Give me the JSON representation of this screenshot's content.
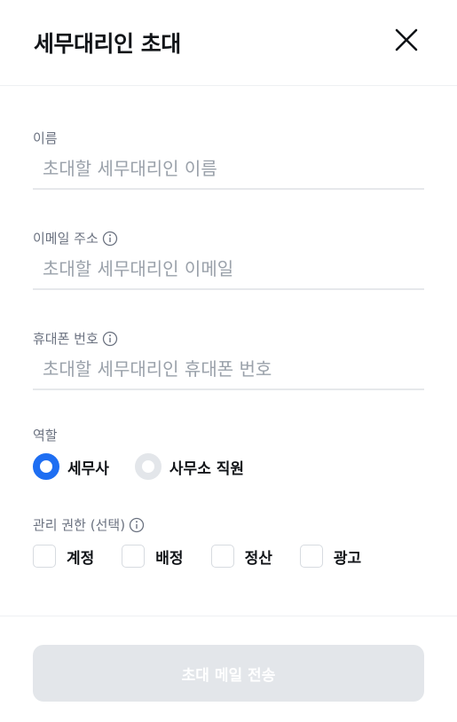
{
  "header": {
    "title": "세무대리인 초대",
    "close_icon": "close-icon"
  },
  "form": {
    "name": {
      "label": "이름",
      "placeholder": "초대할 세무대리인 이름",
      "value": ""
    },
    "email": {
      "label": "이메일 주소",
      "placeholder": "초대할 세무대리인 이메일",
      "value": "",
      "info_icon": "info-icon"
    },
    "phone": {
      "label": "휴대폰 번호",
      "placeholder": "초대할 세무대리인 휴대폰 번호",
      "value": "",
      "info_icon": "info-icon"
    },
    "role": {
      "label": "역할",
      "options": [
        {
          "label": "세무사",
          "selected": true
        },
        {
          "label": "사무소 직원",
          "selected": false
        }
      ]
    },
    "permissions": {
      "label": "관리 권한 (선택)",
      "info_icon": "info-icon",
      "options": [
        {
          "label": "계정",
          "checked": false
        },
        {
          "label": "배정",
          "checked": false
        },
        {
          "label": "정산",
          "checked": false
        },
        {
          "label": "광고",
          "checked": false
        }
      ]
    }
  },
  "footer": {
    "submit_label": "초대 메일 전송",
    "submit_enabled": false
  },
  "colors": {
    "accent": "#1e6ef2",
    "disabled_button": "#e3e6ea",
    "placeholder": "#9aa1aa",
    "label": "#6b7280"
  }
}
